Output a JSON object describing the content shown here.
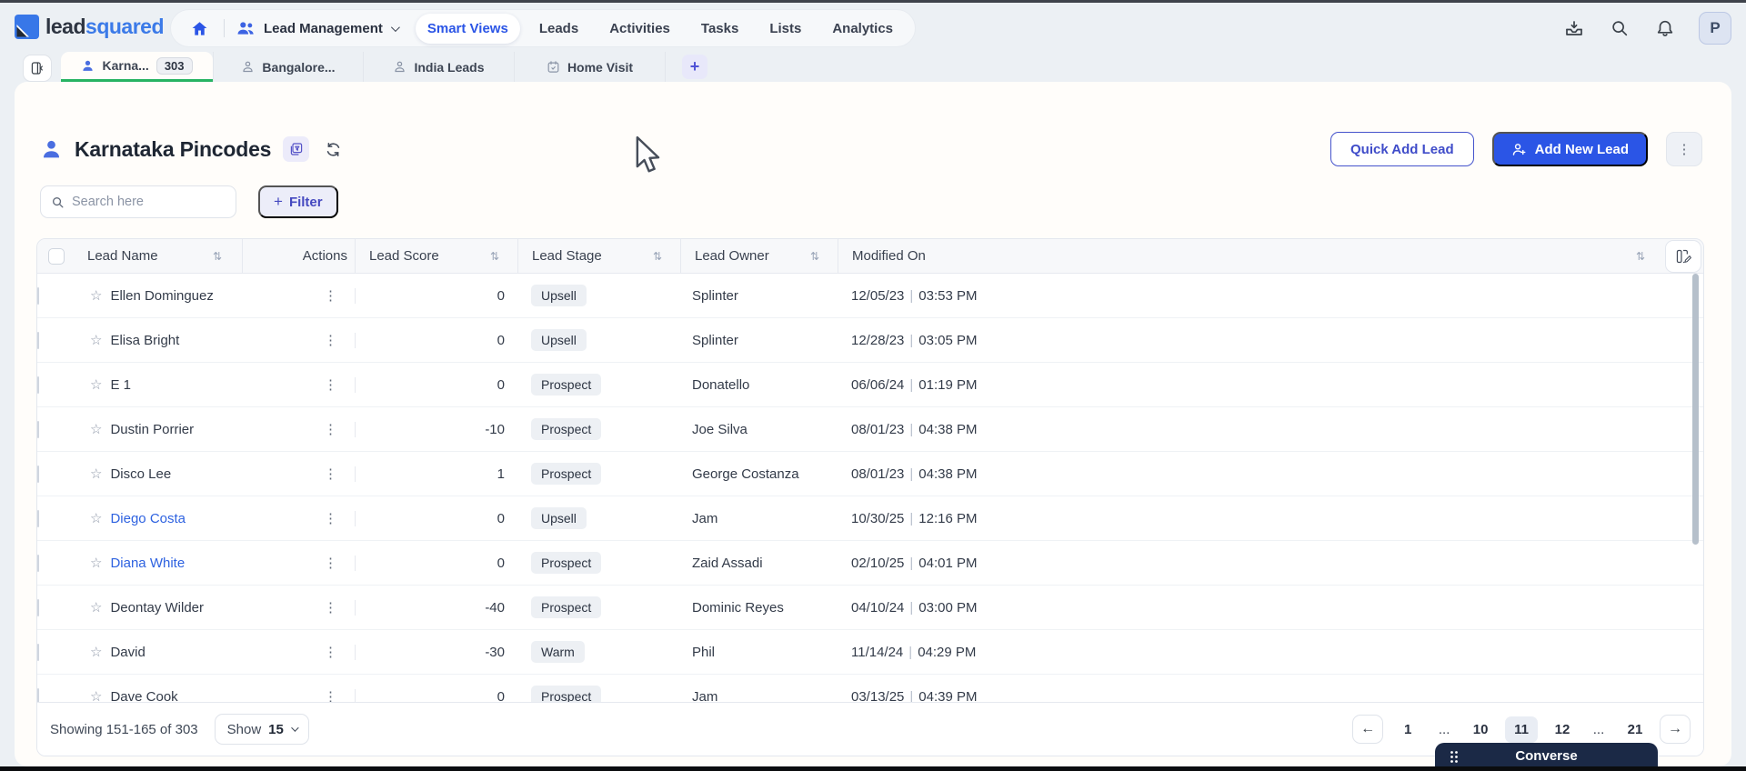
{
  "brand": {
    "logo_lead": "lead",
    "logo_squared": "squared"
  },
  "colors": {
    "accent_blue": "#2b55e6",
    "link_blue": "#2e62e0",
    "tab_active_green": "#27b363",
    "brand_blue": "#3b7ae8",
    "widget_navy": "#1b2946"
  },
  "icons": {
    "kebab": "⋮",
    "star": "☆",
    "sort": "⇅",
    "pipe": "|",
    "plus": "+",
    "prev_arrow": "←",
    "next_arrow": "→"
  },
  "topnav": {
    "workspace": "Lead Management",
    "items": [
      {
        "label": "Smart Views",
        "active": true
      },
      {
        "label": "Leads",
        "active": false
      },
      {
        "label": "Activities",
        "active": false
      },
      {
        "label": "Tasks",
        "active": false
      },
      {
        "label": "Lists",
        "active": false
      },
      {
        "label": "Analytics",
        "active": false
      }
    ],
    "avatar_initial": "P"
  },
  "tabs": [
    {
      "label": "Karna...",
      "badge": "303"
    },
    {
      "label": "Bangalore..."
    },
    {
      "label": "India Leads"
    },
    {
      "label": "Home Visit"
    }
  ],
  "page": {
    "title": "Karnataka Pincodes",
    "search_placeholder": "Search here",
    "filter_label": "Filter",
    "quick_add_label": "Quick Add Lead",
    "add_new_label": "Add New Lead"
  },
  "table": {
    "columns": [
      "Lead Name",
      "Actions",
      "Lead Score",
      "Lead Stage",
      "Lead Owner",
      "Modified On"
    ],
    "rows": [
      {
        "name": "Ellen Dominguez",
        "link": false,
        "score": "0",
        "stage": "Upsell",
        "owner": "Splinter",
        "date": "12/05/23",
        "time": "03:53 PM"
      },
      {
        "name": "Elisa Bright",
        "link": false,
        "score": "0",
        "stage": "Upsell",
        "owner": "Splinter",
        "date": "12/28/23",
        "time": "03:05 PM"
      },
      {
        "name": "E 1",
        "link": false,
        "score": "0",
        "stage": "Prospect",
        "owner": "Donatello",
        "date": "06/06/24",
        "time": "01:19 PM"
      },
      {
        "name": "Dustin Porrier",
        "link": false,
        "score": "-10",
        "stage": "Prospect",
        "owner": "Joe Silva",
        "date": "08/01/23",
        "time": "04:38 PM"
      },
      {
        "name": "Disco Lee",
        "link": false,
        "score": "1",
        "stage": "Prospect",
        "owner": "George Costanza",
        "date": "08/01/23",
        "time": "04:38 PM"
      },
      {
        "name": "Diego Costa",
        "link": true,
        "score": "0",
        "stage": "Upsell",
        "owner": "Jam",
        "date": "10/30/25",
        "time": "12:16 PM"
      },
      {
        "name": "Diana White",
        "link": true,
        "score": "0",
        "stage": "Prospect",
        "owner": "Zaid Assadi",
        "date": "02/10/25",
        "time": "04:01 PM"
      },
      {
        "name": "Deontay Wilder",
        "link": false,
        "score": "-40",
        "stage": "Prospect",
        "owner": "Dominic Reyes",
        "date": "04/10/24",
        "time": "03:00 PM"
      },
      {
        "name": "David",
        "link": false,
        "score": "-30",
        "stage": "Warm",
        "owner": "Phil",
        "date": "11/14/24",
        "time": "04:29 PM"
      },
      {
        "name": "Dave Cook",
        "link": false,
        "score": "0",
        "stage": "Prospect",
        "owner": "Jam",
        "date": "03/13/25",
        "time": "04:39 PM"
      }
    ]
  },
  "footer": {
    "showing": "Showing 151-165 of 303",
    "show_label": "Show",
    "show_value": "15",
    "pages": [
      "1",
      "...",
      "10",
      "11",
      "12",
      "...",
      "21"
    ],
    "active_page": "11"
  },
  "widget": {
    "title": "Converse"
  }
}
